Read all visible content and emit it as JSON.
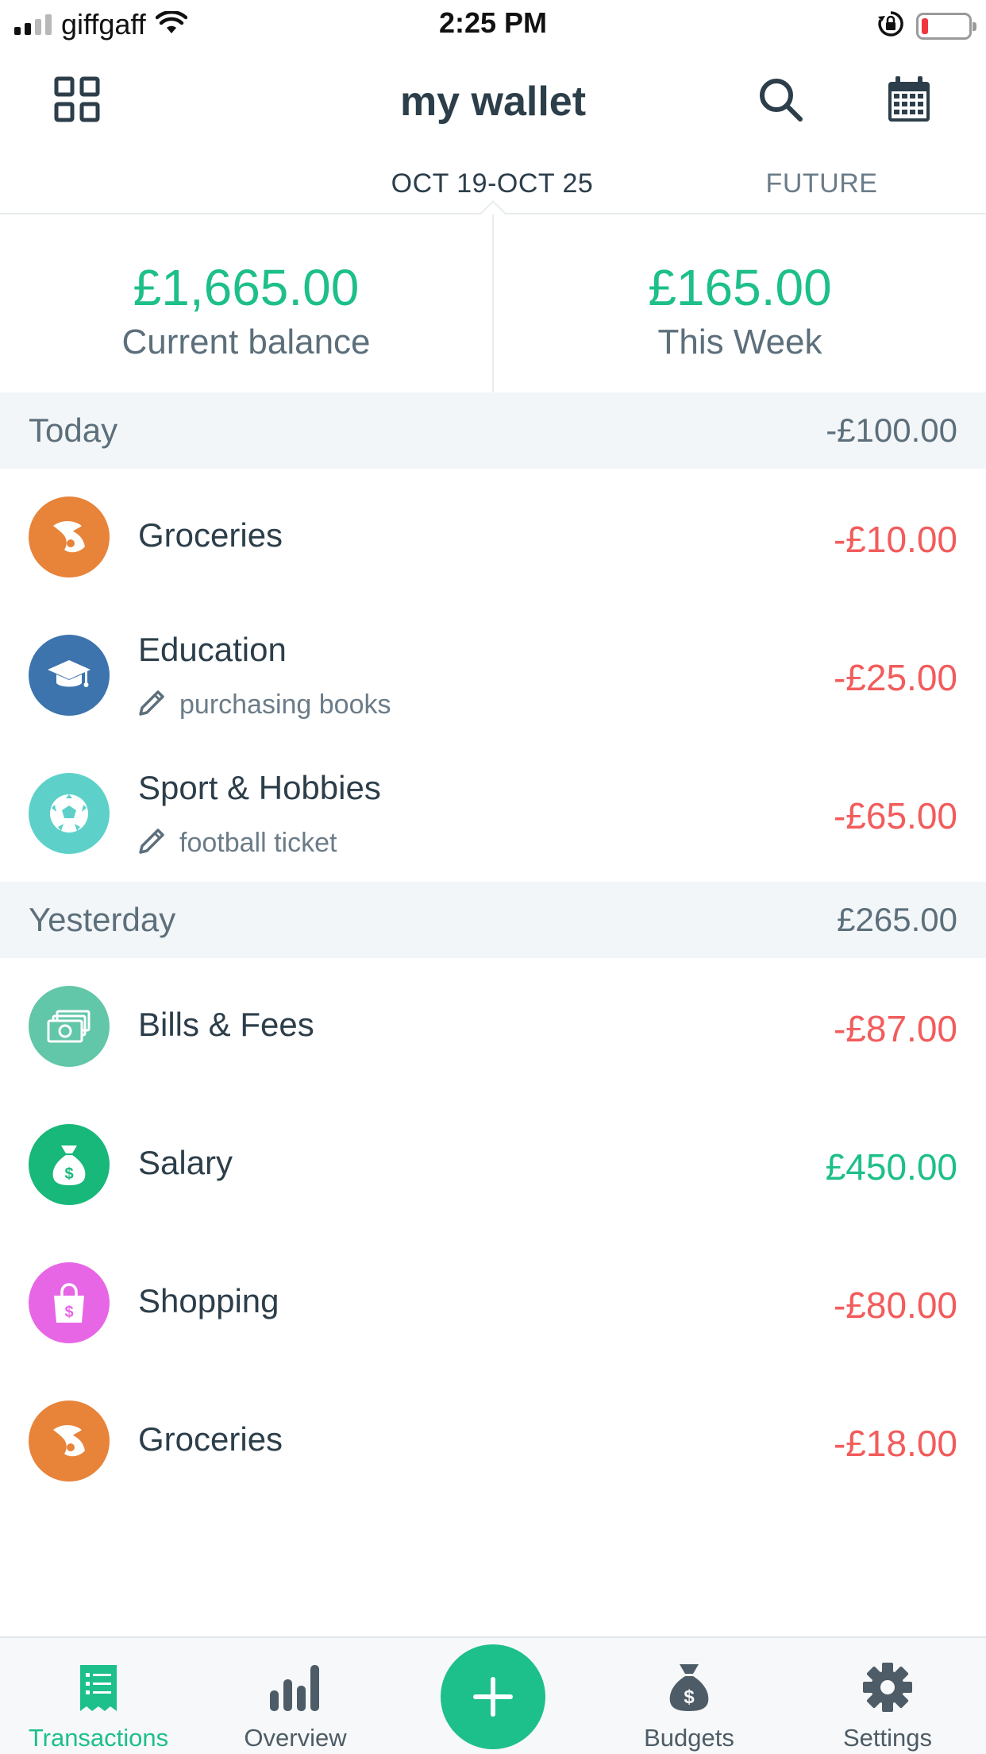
{
  "status_bar": {
    "carrier": "giffgaff",
    "time": "2:25 PM",
    "battery_color": "#f0353f"
  },
  "header": {
    "title": "my wallet",
    "left_icon": "grid-icon",
    "right_icons": [
      "search-icon",
      "calendar-icon"
    ]
  },
  "period_tabs": {
    "active": "OCT 19-OCT 25",
    "future": "FUTURE"
  },
  "summary": {
    "balance_amount": "£1,665.00",
    "balance_label": "Current balance",
    "week_amount": "£165.00",
    "week_label": "This Week"
  },
  "sections": [
    {
      "label": "Today",
      "total": "-£100.00",
      "transactions": [
        {
          "category": "Groceries",
          "note": "",
          "amount": "-£10.00",
          "icon": "croissant-icon",
          "color": "#e8833a"
        },
        {
          "category": "Education",
          "note": "purchasing books",
          "amount": "-£25.00",
          "icon": "graduation-cap-icon",
          "color": "#3d74ae"
        },
        {
          "category": "Sport & Hobbies",
          "note": "football ticket",
          "amount": "-£65.00",
          "icon": "soccer-ball-icon",
          "color": "#5dd1c9"
        }
      ]
    },
    {
      "label": "Yesterday",
      "total": "£265.00",
      "transactions": [
        {
          "category": "Bills & Fees",
          "note": "",
          "amount": "-£87.00",
          "icon": "banknotes-icon",
          "color": "#62c6a8"
        },
        {
          "category": "Salary",
          "note": "",
          "amount": "£450.00",
          "icon": "money-bag-icon",
          "color": "#18b77a"
        },
        {
          "category": "Shopping",
          "note": "",
          "amount": "-£80.00",
          "icon": "shopping-bag-icon",
          "color": "#e766e6"
        },
        {
          "category": "Groceries",
          "note": "",
          "amount": "-£18.00",
          "icon": "croissant-icon",
          "color": "#e8833a"
        }
      ]
    }
  ],
  "bottom_nav": {
    "items": [
      {
        "label": "Transactions",
        "icon": "receipt-icon",
        "active": true
      },
      {
        "label": "Overview",
        "icon": "bar-chart-icon",
        "active": false
      },
      {
        "label": "Budgets",
        "icon": "money-bag-icon",
        "active": false
      },
      {
        "label": "Settings",
        "icon": "gear-icon",
        "active": false
      }
    ],
    "add_icon": "plus-icon"
  },
  "colors": {
    "accent": "#1dbf8a",
    "negative": "#f25c5c",
    "text": "#2c3e4a",
    "muted": "#5c6f7b"
  }
}
